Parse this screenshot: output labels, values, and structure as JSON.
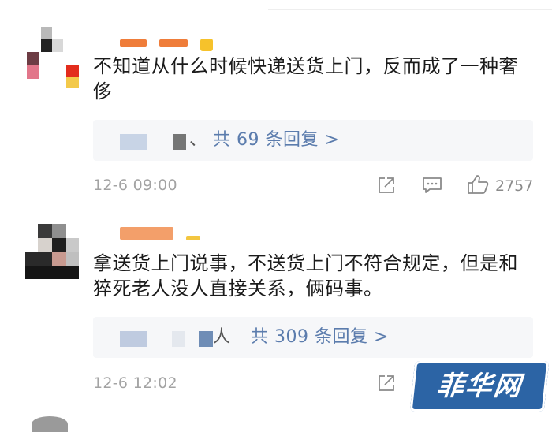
{
  "comments": [
    {
      "text": "不知道从什么时候快递送货上门，反而成了一种奢侈",
      "reply_partial": "、",
      "reply_link": "共 69 条回复 >",
      "time": "12-6 09:00",
      "likes": "2757",
      "icons": [
        "share-icon",
        "comment-icon",
        "like-icon"
      ]
    },
    {
      "text": "拿送货上门说事，不送货上门不符合规定，但是和猝死老人没人直接关系，俩码事。",
      "reply_partial": "人",
      "reply_link": "共 309 条回复 >",
      "time": "12-6 12:02",
      "icons": [
        "share-icon"
      ]
    }
  ],
  "watermark": {
    "text": "菲华网"
  },
  "colors": {
    "link": "#5b7cad",
    "watermark_bg": "#2c64a5",
    "reply_bg": "#f6f7f9",
    "time": "#a3a3a3"
  }
}
